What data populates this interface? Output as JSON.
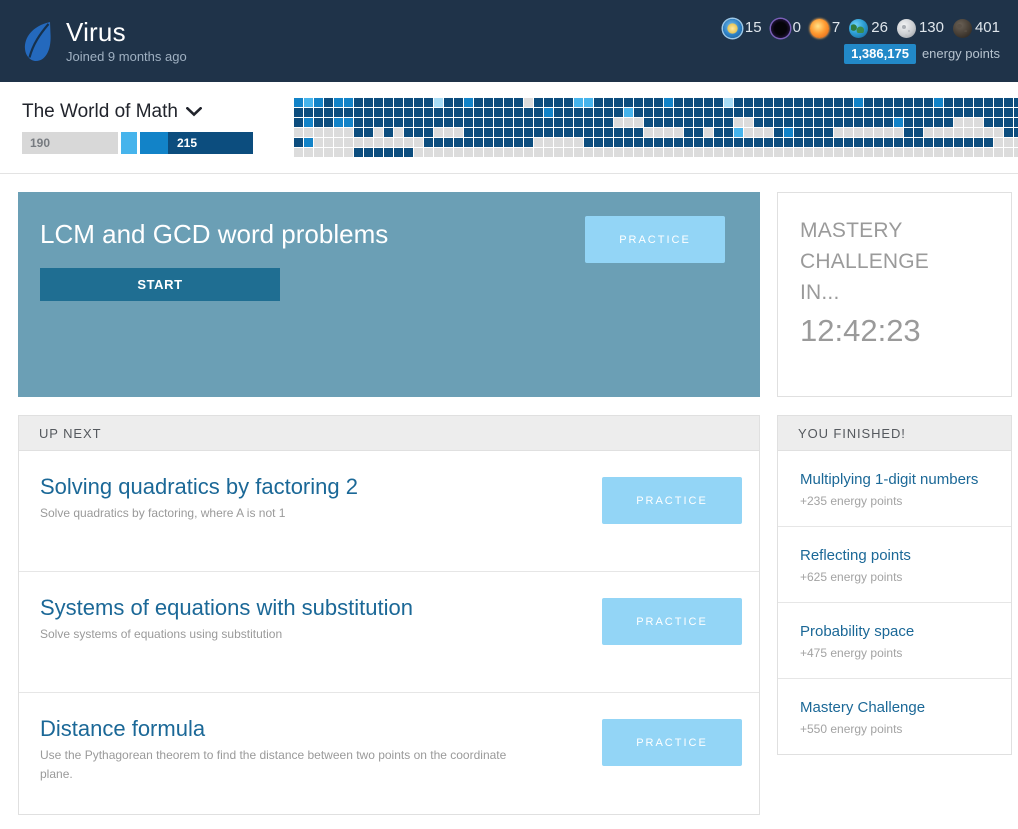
{
  "header": {
    "logo_icon": "leaf-icon",
    "user_name": "Virus",
    "joined_text": "Joined 9 months ago",
    "badges": [
      {
        "icon": "sun-badge-icon",
        "count": "15"
      },
      {
        "icon": "black-hole-badge-icon",
        "count": "0"
      },
      {
        "icon": "sun-orange-badge-icon",
        "count": "7"
      },
      {
        "icon": "earth-badge-icon",
        "count": "26"
      },
      {
        "icon": "moon-badge-icon",
        "count": "130"
      },
      {
        "icon": "meteorite-badge-icon",
        "count": "401"
      }
    ],
    "energy_points_value": "1,386,175",
    "energy_points_label": "energy points",
    "energy_pill_color": "#2289c8",
    "background_color": "#1f3349"
  },
  "subheader": {
    "course_title": "The World of Math",
    "dropdown_icon": "chevron-down-icon",
    "progress": {
      "left_value": "190",
      "right_value": "215",
      "gray_color": "#d8d8d8",
      "light_blue_color": "#46b4ec",
      "mid_blue_color": "#1283c8",
      "dark_blue_color": "#0c4d7e"
    },
    "heatmap": {
      "legend_colors": [
        "#dcdcdc",
        "#a8dcf5",
        "#46b4ec",
        "#1283c8",
        "#0c4d7e"
      ],
      "rows": 6,
      "cols": 74,
      "cells": [
        [
          3,
          2,
          3,
          4,
          3,
          3,
          4,
          4,
          4,
          4,
          4,
          4,
          4,
          4,
          1,
          4,
          4,
          3,
          4,
          4,
          4,
          4,
          4,
          0,
          4,
          4,
          4,
          4,
          2,
          2,
          4,
          4,
          4,
          4,
          4,
          4,
          4,
          3,
          4,
          4,
          4,
          4,
          4,
          1,
          4,
          4,
          4,
          4,
          4,
          4,
          4,
          4,
          4,
          4,
          4,
          4,
          3,
          4,
          4,
          4,
          4,
          4,
          4,
          4,
          3,
          4,
          4,
          4,
          4,
          4,
          4,
          4,
          4,
          4
        ],
        [
          4,
          4,
          4,
          4,
          4,
          4,
          4,
          4,
          4,
          4,
          4,
          4,
          4,
          4,
          4,
          4,
          4,
          4,
          4,
          4,
          4,
          4,
          4,
          4,
          4,
          3,
          4,
          4,
          4,
          4,
          4,
          4,
          4,
          2,
          4,
          4,
          4,
          4,
          4,
          4,
          4,
          4,
          4,
          4,
          4,
          4,
          4,
          4,
          4,
          4,
          4,
          4,
          4,
          4,
          4,
          4,
          4,
          4,
          4,
          4,
          4,
          4,
          4,
          4,
          4,
          4,
          4,
          4,
          4,
          4,
          4,
          4,
          4,
          4
        ],
        [
          4,
          3,
          4,
          4,
          3,
          3,
          4,
          4,
          4,
          4,
          4,
          4,
          4,
          4,
          4,
          4,
          4,
          4,
          4,
          4,
          4,
          4,
          4,
          4,
          4,
          4,
          4,
          4,
          4,
          4,
          4,
          4,
          0,
          0,
          0,
          4,
          4,
          4,
          4,
          4,
          4,
          4,
          4,
          4,
          0,
          0,
          4,
          4,
          4,
          4,
          4,
          4,
          4,
          4,
          4,
          4,
          4,
          4,
          4,
          4,
          3,
          4,
          4,
          4,
          4,
          4,
          0,
          0,
          0,
          4,
          4,
          4,
          4,
          4
        ],
        [
          0,
          0,
          0,
          0,
          0,
          0,
          4,
          4,
          0,
          4,
          0,
          4,
          4,
          4,
          0,
          0,
          0,
          4,
          4,
          4,
          4,
          4,
          4,
          4,
          4,
          4,
          4,
          4,
          4,
          4,
          4,
          4,
          4,
          4,
          4,
          0,
          0,
          0,
          0,
          4,
          4,
          0,
          4,
          4,
          2,
          0,
          0,
          0,
          4,
          3,
          4,
          4,
          4,
          4,
          0,
          0,
          0,
          0,
          0,
          0,
          0,
          4,
          4,
          0,
          0,
          0,
          0,
          0,
          0,
          0,
          0,
          4,
          4,
          0
        ],
        [
          4,
          3,
          0,
          0,
          0,
          0,
          0,
          0,
          0,
          0,
          0,
          0,
          0,
          4,
          4,
          4,
          4,
          4,
          4,
          4,
          4,
          4,
          4,
          4,
          0,
          0,
          0,
          0,
          0,
          4,
          4,
          4,
          4,
          4,
          4,
          4,
          4,
          4,
          4,
          4,
          4,
          4,
          4,
          4,
          4,
          4,
          4,
          4,
          4,
          4,
          4,
          4,
          4,
          4,
          4,
          4,
          4,
          4,
          4,
          4,
          4,
          4,
          4,
          4,
          4,
          4,
          4,
          4,
          4,
          4,
          0,
          0,
          0,
          0
        ],
        [
          0,
          0,
          0,
          0,
          0,
          0,
          4,
          4,
          4,
          4,
          4,
          4,
          0,
          0,
          0,
          0,
          0,
          0,
          0,
          0,
          0,
          0,
          0,
          0,
          0,
          0,
          0,
          0,
          0,
          0,
          0,
          0,
          0,
          0,
          0,
          0,
          0,
          0,
          0,
          0,
          0,
          0,
          0,
          0,
          0,
          0,
          0,
          0,
          0,
          0,
          0,
          0,
          0,
          0,
          0,
          0,
          0,
          0,
          0,
          0,
          0,
          0,
          0,
          0,
          0,
          0,
          0,
          0,
          0,
          0,
          0,
          0,
          0,
          4
        ]
      ]
    }
  },
  "hero": {
    "title": "LCM and GCD word problems",
    "start_label": "START",
    "practice_label": "PRACTICE",
    "background_color": "#6b9fb5",
    "start_color": "#1f6e92",
    "practice_color": "#93d5f6"
  },
  "mastery": {
    "label_line1": "MASTERY",
    "label_line2": "CHALLENGE",
    "label_line3": "IN...",
    "countdown": "12:42:23"
  },
  "up_next": {
    "header": "UP NEXT",
    "items": [
      {
        "title": "Solving quadratics by factoring 2",
        "description": "Solve quadratics by factoring, where A is not 1",
        "practice_label": "PRACTICE"
      },
      {
        "title": "Systems of equations with substitution",
        "description": "Solve systems of equations using substitution",
        "practice_label": "PRACTICE"
      },
      {
        "title": "Distance formula",
        "description": "Use the Pythagorean theorem to find the distance between two points on the coordinate plane.",
        "practice_label": "PRACTICE"
      }
    ]
  },
  "you_finished": {
    "header": "YOU FINISHED!",
    "items": [
      {
        "title": "Multiplying 1-digit numbers",
        "points": "+235 energy points"
      },
      {
        "title": "Reflecting points",
        "points": "+625 energy points"
      },
      {
        "title": "Probability space",
        "points": "+475 energy points"
      },
      {
        "title": "Mastery Challenge",
        "points": "+550 energy points"
      }
    ]
  }
}
